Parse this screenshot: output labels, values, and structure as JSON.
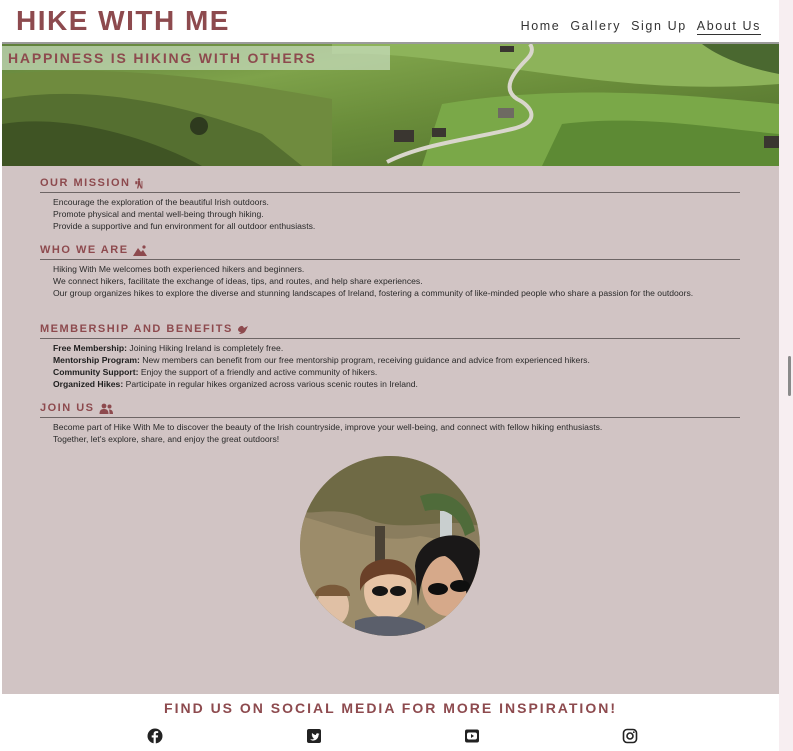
{
  "header": {
    "logo": "HIKE WITH ME",
    "nav": [
      {
        "label": "Home"
      },
      {
        "label": "Gallery"
      },
      {
        "label": "Sign Up"
      },
      {
        "label": "About Us",
        "active": true
      }
    ]
  },
  "hero": {
    "tagline": "HAPPINESS IS HIKING WITH OTHERS"
  },
  "sections": [
    {
      "title": "OUR MISSION",
      "icon": "hiker-icon",
      "lines": [
        "Encourage the exploration of the beautiful Irish outdoors.",
        "Promote physical and mental well-being through hiking.",
        "Provide a supportive and fun environment for all outdoor enthusiasts."
      ]
    },
    {
      "title": "WHO WE ARE",
      "icon": "mountain-icon",
      "lines": [
        "Hiking With Me welcomes both experienced hikers and beginners.",
        "We connect hikers, facilitate the exchange of ideas, tips, and routes, and help share experiences.",
        "Our group organizes hikes to explore the diverse and stunning landscapes of Ireland, fostering a community of like-minded people who share a passion for the outdoors."
      ]
    },
    {
      "title": "MEMBERSHIP AND BENEFITS",
      "icon": "dove-icon",
      "items": [
        {
          "label": "Free Membership:",
          "text": " Joining Hiking Ireland is completely free."
        },
        {
          "label": "Mentorship Program:",
          "text": " New members can benefit from our free mentorship program, receiving guidance and advice from experienced hikers."
        },
        {
          "label": "Community Support:",
          "text": " Enjoy the support of a friendly and active community of hikers."
        },
        {
          "label": "Organized Hikes:",
          "text": " Participate in regular hikes organized across various scenic routes in Ireland."
        }
      ]
    },
    {
      "title": "JOIN US",
      "icon": "users-icon",
      "lines": [
        "Become part of Hike With Me to discover the beauty of the Irish countryside, improve your well-being, and connect with fellow hiking enthusiasts.",
        "Together, let's explore, share, and enjoy the great outdoors!"
      ]
    }
  ],
  "footer": {
    "title": "FIND US ON SOCIAL MEDIA FOR MORE INSPIRATION!",
    "social": [
      "facebook-icon",
      "twitter-icon",
      "youtube-icon",
      "instagram-icon"
    ]
  },
  "colors": {
    "brand": "#8d4a4e",
    "content_bg": "#d1c4c4"
  }
}
